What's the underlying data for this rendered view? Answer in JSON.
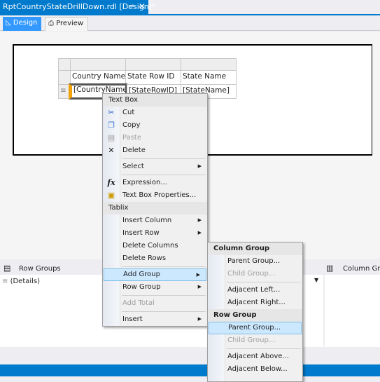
{
  "document_tab": {
    "title": "RptCountryStateDrillDown.rdl [Design]*",
    "pin_icon": "pin-icon",
    "close_icon": "close-icon"
  },
  "view_tabs": [
    {
      "label": "Design",
      "active": true
    },
    {
      "label": "Preview",
      "active": false
    }
  ],
  "tablix": {
    "headers": [
      "Country Name",
      "State Row ID",
      "State Name"
    ],
    "row": [
      "[CountryName]",
      "[StateRowID]",
      "[StateName]"
    ]
  },
  "grouping": {
    "row_groups_label": "Row Groups",
    "column_groups_label": "Column Gro",
    "details": "(Details)"
  },
  "context_menu": {
    "section1": "Text Box",
    "cut": "Cut",
    "copy": "Copy",
    "paste": "Paste",
    "delete": "Delete",
    "select": "Select",
    "expression": "Expression...",
    "textbox_props": "Text Box Properties...",
    "section2": "Tablix",
    "insert_column": "Insert Column",
    "insert_row": "Insert Row",
    "delete_columns": "Delete Columns",
    "delete_rows": "Delete Rows",
    "add_group": "Add Group",
    "row_group": "Row Group",
    "add_total": "Add Total",
    "insert": "Insert"
  },
  "submenu": {
    "column_group": "Column Group",
    "col_parent": "Parent Group...",
    "col_child": "Child Group...",
    "adj_left": "Adjacent Left...",
    "adj_right": "Adjacent Right...",
    "row_group": "Row Group",
    "row_parent": "Parent Group...",
    "row_child": "Child Group...",
    "adj_above": "Adjacent Above...",
    "adj_below": "Adjacent Below..."
  },
  "colors": {
    "accent": "#007acc",
    "highlight": "#cce8ff",
    "selected_cell": "#f0a30a"
  }
}
